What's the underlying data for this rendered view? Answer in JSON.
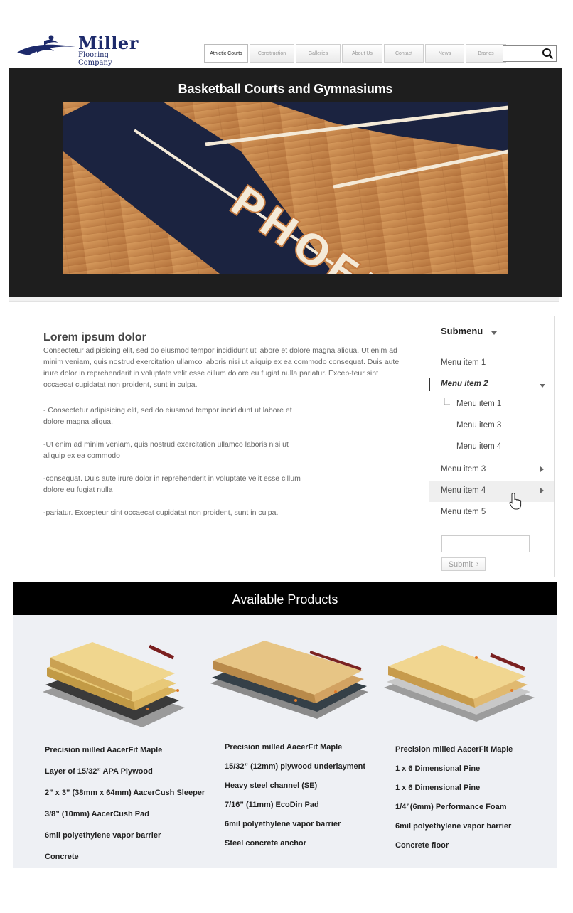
{
  "brand": {
    "name": "Miller",
    "tagline": "Flooring Company"
  },
  "nav": {
    "tabs": [
      "Athletic Courts",
      "Construction",
      "Galleries",
      "About Us",
      "Contact",
      "News",
      "Brands"
    ],
    "active": "Athletic Courts"
  },
  "search": {
    "value": ""
  },
  "hero": {
    "title": "Basketball Courts and Gymnasiums",
    "court_text": "PHOENIX",
    "prev": "‹",
    "next": "›"
  },
  "content": {
    "title": "Lorem ipsum dolor",
    "intro": "Consectetur adipisicing elit, sed do eiusmod tempor incididunt ut labore et dolore magna aliqua. Ut enim ad minim veniam, quis nostrud exercitation ullamco laboris nisi ut aliquip ex ea commodo consequat. Duis aute irure dolor in reprehenderit in voluptate velit esse cillum dolore eu fugiat nulla pariatur. Excep-teur sint occaecat cupidatat non proident, sunt in culpa.",
    "bullets": [
      "- Consectetur adipisicing elit, sed do eiusmod tempor incididunt ut labore et dolore magna aliqua.",
      " -Ut enim ad minim veniam, quis nostrud exercitation ullamco laboris nisi ut aliquip ex ea commodo",
      "-consequat. Duis aute irure dolor in reprehenderit in voluptate velit esse cillum dolore eu fugiat nulla",
      "-pariatur. Excepteur sint occaecat cupidatat non proident, sunt in culpa."
    ]
  },
  "sidebar": {
    "heading": "Submenu",
    "items": [
      {
        "label": "Menu item 1"
      },
      {
        "label": "Menu item 2"
      },
      {
        "label": "Menu item 1"
      },
      {
        "label": "Menu item 3"
      },
      {
        "label": "Menu item 4"
      },
      {
        "label": "Menu item 3"
      },
      {
        "label": "Menu item 4"
      },
      {
        "label": "Menu item 5"
      }
    ],
    "input_value": "",
    "submit_label": "Submit"
  },
  "products": {
    "heading": "Available Products",
    "items": [
      {
        "specs": [
          "Precision milled AacerFit Maple",
          "Layer of 15/32” APA Plywood",
          "2” x 3” (38mm x 64mm) AacerCush Sleeper",
          "3/8” (10mm) AacerCush Pad",
          "6mil polyethylene vapor barrier",
          "Concrete"
        ]
      },
      {
        "specs": [
          "Precision milled AacerFit Maple",
          "15/32”  (12mm) plywood underlayment",
          "Heavy steel channel (SE)",
          "7/16” (11mm) EcoDin Pad",
          "6mil polyethylene vapor barrier",
          "Steel concrete anchor"
        ]
      },
      {
        "specs": [
          "Precision milled AacerFit Maple",
          "1 x 6 Dimensional Pine",
          "1 x 6 Dimensional Pine",
          "1/4”(6mm) Performance Foam",
          "6mil polyethylene vapor barrier",
          "Concrete floor"
        ]
      }
    ]
  },
  "colors": {
    "brand_navy": "#1d2a6b",
    "hero_bg": "#1e1e1e",
    "products_bg": "#eef0f4",
    "court_wood": "#c48a52",
    "court_paint": "#1b2340"
  }
}
